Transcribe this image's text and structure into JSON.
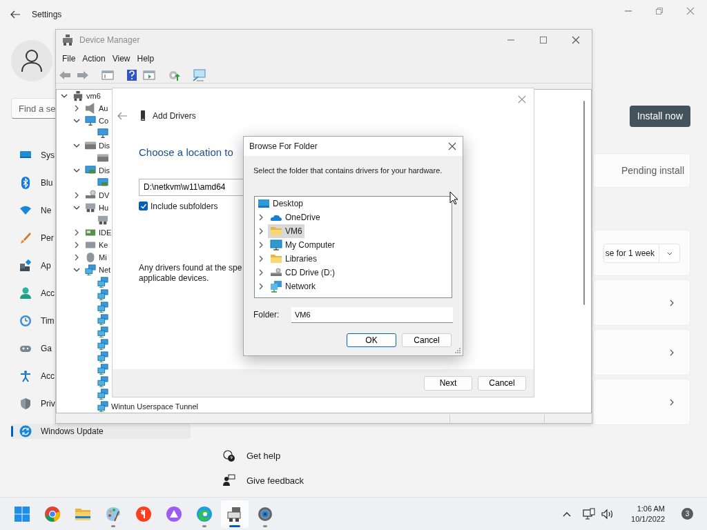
{
  "settings": {
    "title": "Settings",
    "search": {
      "placeholder": "Find a se"
    },
    "nav": [
      {
        "label": "Sys",
        "kind": "system",
        "selected": false
      },
      {
        "label": "Blu",
        "kind": "bluetooth",
        "selected": false
      },
      {
        "label": "Ne",
        "kind": "network",
        "selected": false
      },
      {
        "label": "Per",
        "kind": "personalization",
        "selected": false
      },
      {
        "label": "Ap",
        "kind": "apps",
        "selected": false
      },
      {
        "label": "Acc",
        "kind": "accounts",
        "selected": false
      },
      {
        "label": "Tim",
        "kind": "time",
        "selected": false
      },
      {
        "label": "Ga",
        "kind": "gaming",
        "selected": false
      },
      {
        "label": "Acc",
        "kind": "accessibility",
        "selected": false
      },
      {
        "label": "Priv",
        "kind": "privacy",
        "selected": false
      },
      {
        "label": "Windows Update",
        "kind": "update",
        "selected": true
      }
    ],
    "install_button": "Install now",
    "status_text": "Pending install",
    "pause_dropdown": "se for 1 week",
    "help_links": [
      {
        "label": "Get help",
        "kind": "help"
      },
      {
        "label": "Give feedback",
        "kind": "feedback"
      }
    ]
  },
  "device_manager": {
    "title": "Device Manager",
    "menu": [
      "File",
      "Action",
      "View",
      "Help"
    ],
    "tree": {
      "label": "vm6",
      "kind": "computer",
      "expanded": true,
      "children": [
        {
          "label": "Au",
          "kind": "audio",
          "expanded": false
        },
        {
          "label": "Co",
          "kind": "monitor",
          "expanded": true,
          "children": [
            {
              "kind": "monitor"
            }
          ]
        },
        {
          "label": "Dis",
          "kind": "disk",
          "expanded": true,
          "children": [
            {
              "kind": "disk"
            }
          ]
        },
        {
          "label": "Dis",
          "kind": "display",
          "expanded": true,
          "children": [
            {
              "kind": "display"
            }
          ]
        },
        {
          "label": "DV",
          "kind": "dvd",
          "expanded": false
        },
        {
          "label": "Hu",
          "kind": "hid",
          "expanded": true,
          "children": [
            {
              "kind": "hid"
            }
          ]
        },
        {
          "label": "IDE",
          "kind": "ide",
          "expanded": false
        },
        {
          "label": "Ke",
          "kind": "keyboard",
          "expanded": false
        },
        {
          "label": "Mi",
          "kind": "mouse",
          "expanded": false
        },
        {
          "label": "Net",
          "kind": "network",
          "expanded": true,
          "children": [
            {
              "kind": "network"
            },
            {
              "kind": "network"
            },
            {
              "kind": "network"
            },
            {
              "kind": "network"
            },
            {
              "kind": "network"
            },
            {
              "kind": "network"
            },
            {
              "kind": "network"
            },
            {
              "kind": "network"
            },
            {
              "kind": "network"
            },
            {
              "kind": "network"
            },
            {
              "label": "Wintun Userspace Tunnel",
              "kind": "network"
            }
          ]
        }
      ]
    }
  },
  "add_drivers": {
    "title": "Add Drivers",
    "heading": "Choose a location to",
    "path": "D:\\netkvm\\w11\\amd64",
    "include_subfolders": {
      "label": "Include subfolders",
      "checked": true
    },
    "note_lines": [
      "Any drivers found at the spe",
      "applicable devices."
    ],
    "buttons": [
      "Next",
      "Cancel"
    ]
  },
  "browse_dialog": {
    "title": "Browse For Folder",
    "instruction": "Select the folder that contains drivers for your hardware.",
    "tree": {
      "label": "Desktop",
      "kind": "desktop",
      "selected": false,
      "children": [
        {
          "label": "OneDrive",
          "kind": "cloud",
          "expanded": false,
          "selected": false
        },
        {
          "label": "VM6",
          "kind": "folder",
          "expanded": false,
          "selected": true
        },
        {
          "label": "My Computer",
          "kind": "computer",
          "expanded": false,
          "selected": false
        },
        {
          "label": "Libraries",
          "kind": "folder",
          "expanded": false,
          "selected": false
        },
        {
          "label": "CD Drive (D:)",
          "kind": "cd",
          "expanded": false,
          "selected": false
        },
        {
          "label": "Network",
          "kind": "network",
          "expanded": false,
          "selected": false
        }
      ]
    },
    "folder_label": "Folder:",
    "folder_value": "VM6",
    "buttons": [
      {
        "label": "OK",
        "default": true
      },
      {
        "label": "Cancel",
        "default": false
      }
    ]
  },
  "taskbar": {
    "apps": [
      {
        "kind": "start",
        "running": false,
        "selected": false
      },
      {
        "kind": "chrome",
        "running": false,
        "selected": false
      },
      {
        "kind": "explorer",
        "running": false,
        "selected": false
      },
      {
        "kind": "paint",
        "running": true,
        "selected": false
      },
      {
        "kind": "yandex",
        "running": false,
        "selected": false
      },
      {
        "kind": "alice",
        "running": false,
        "selected": false
      },
      {
        "kind": "edge",
        "running": true,
        "selected": false
      },
      {
        "kind": "devmgr",
        "running": true,
        "selected": true
      },
      {
        "kind": "settings",
        "running": true,
        "selected": false
      }
    ],
    "time": "1:06 AM",
    "date": "10/1/2022",
    "notifications": "3"
  }
}
